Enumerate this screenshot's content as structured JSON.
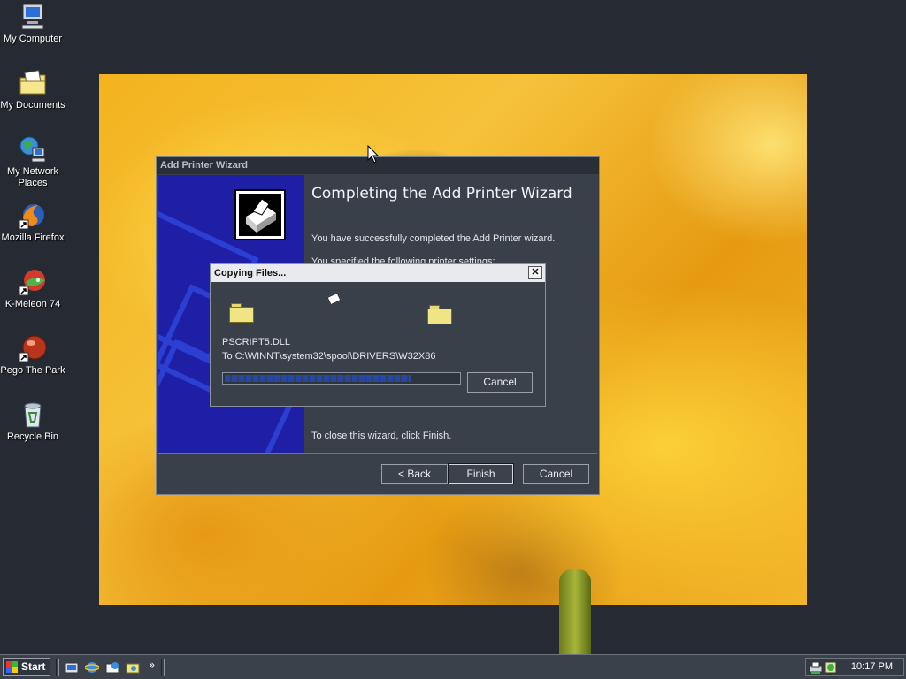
{
  "desktop": {
    "icons": [
      {
        "label": "My Computer"
      },
      {
        "label": "My Documents"
      },
      {
        "label": "My Network Places"
      },
      {
        "label": "Mozilla Firefox"
      },
      {
        "label": "K-Meleon 74"
      },
      {
        "label": "Pego The Park"
      },
      {
        "label": "Recycle Bin"
      }
    ]
  },
  "wizard": {
    "title": "Add Printer Wizard",
    "heading": "Completing the Add Printer Wizard",
    "success_text": "You have successfully completed the Add Printer wizard.",
    "settings_text": "You specified the following printer settings:",
    "close_text": "To close this wizard, click Finish.",
    "back_label": "< Back",
    "finish_label": "Finish",
    "cancel_label": "Cancel"
  },
  "copy_dialog": {
    "title": "Copying Files...",
    "close_glyph": "✕",
    "filename": "PSCRIPT5.DLL",
    "destination": "To C:\\WINNT\\system32\\spool\\DRIVERS\\W32X86",
    "progress_percent": 80,
    "cancel_label": "Cancel"
  },
  "taskbar": {
    "start_label": "Start",
    "chevron": "»",
    "clock": "10:17 PM"
  },
  "colors": {
    "desktop_bg": "#262b33",
    "wizard_side": "#1f1fa6",
    "progress_fill": "#2447a8"
  }
}
